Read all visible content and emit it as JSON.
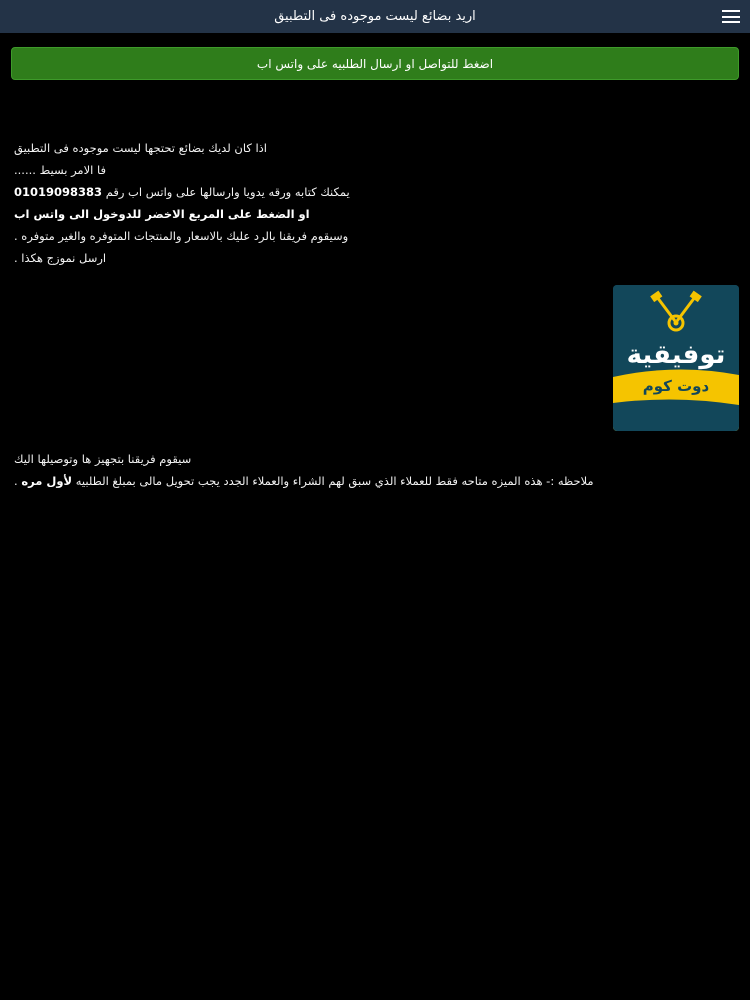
{
  "appbar": {
    "title": "اريد بضائع ليست موجوده فى التطبيق",
    "menu_icon": "hamburger-menu-icon"
  },
  "whatsapp_button": {
    "label": "اضغط للتواصل او ارسال الطلبيه على واتس اب",
    "color": "#2f7d1b"
  },
  "body": {
    "line1": "اذا كان لديك بضائع تحتجها ليست موجوده فى التطبيق",
    "line2": "فا الامر بسيط ......",
    "line3_text": "يمكنك كتابه ورقه يدويا وارسالها على واتس اب رقم",
    "line3_number": "01019098383",
    "line4": "او الضغط على المربع الاخضر للدوخول الى واتس اب",
    "line5": "وسيقوم فريقنا بالرد عليك بالاسعار والمنتجات المتوفره والغير متوفره .",
    "line6": "ارسل نموزج هكذا .",
    "line7": "سيقوم فريقنا بتجهيز ها  وتوصيلها اليك",
    "note_text": "ملاحظه :- هذه الميزه متاحه فقط للعملاء الذي سبق لهم الشراء والعملاء الجدد يجب تحويل مالى بمبلغ الطلبيه",
    "note_bold": "لأول مره",
    "note_end": "."
  },
  "logo": {
    "main_text": "توفيقية",
    "sub_text": "دوت كوم",
    "bg_color": "#12475a",
    "accent_color": "#f5c400"
  }
}
